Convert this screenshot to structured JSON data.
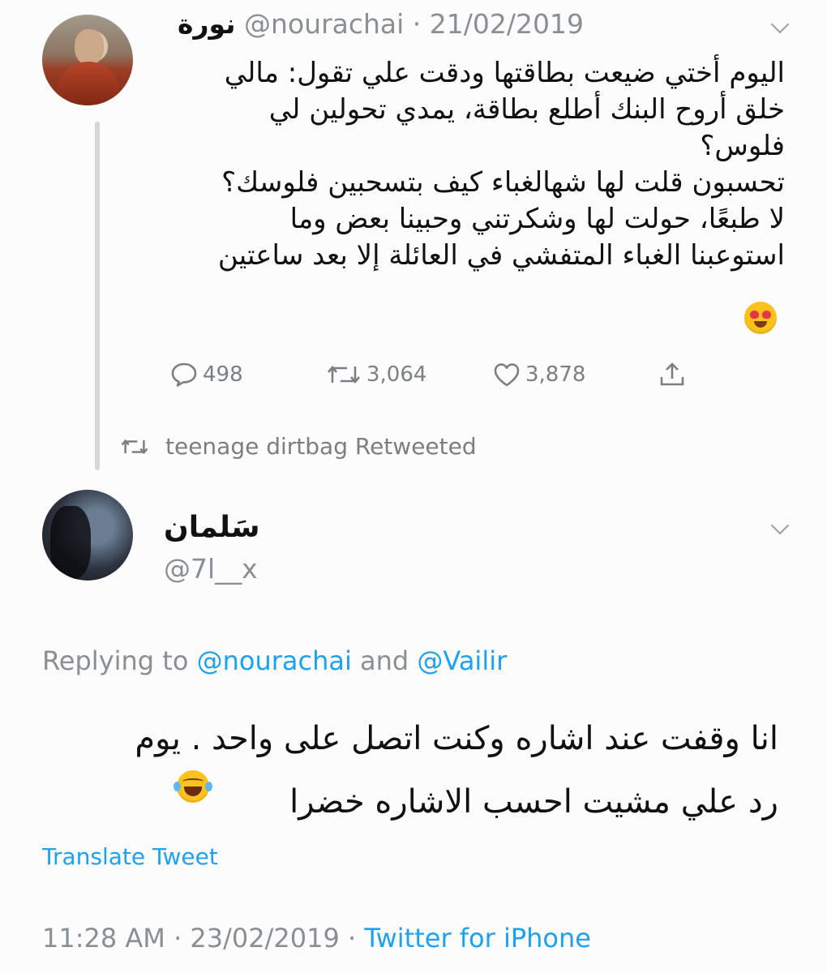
{
  "tweet1": {
    "display_name": "نورة",
    "handle": "@nourachai",
    "separator": " · ",
    "date": "21/02/2019",
    "text_lines": [
      "اليوم أختي ضيعت بطاقتها ودقت علي تقول: مالي",
      "خلق أروح البنك أطلع بطاقة، يمدي تحولين لي",
      "فلوس؟",
      "تحسبون قلت لها شهالغباء كيف بتسحبين فلوسك؟",
      "لا طبعًا، حولت لها وشكرتني وحبينا بعض وما",
      "استوعبنا الغباء المتفشي في العائلة إلا بعد ساعتين"
    ],
    "emoji": "heart-eyes-emoji",
    "actions": {
      "replies": "498",
      "retweets": "3,064",
      "likes": "3,878"
    }
  },
  "retweet_notice": {
    "icon": "retweet-icon",
    "text": "teenage dirtbag Retweeted"
  },
  "tweet2": {
    "display_name": "سَلمان",
    "handle": "@7l__x",
    "replying_prefix": "Replying to ",
    "replying_user1": "@nourachai",
    "replying_and": " and ",
    "replying_user2": "@Vailir",
    "text_lines": [
      "انا وقفت عند اشاره وكنت اتصل على واحد . يوم",
      "رد علي مشيت احسب الاشاره خضرا"
    ],
    "emoji": "tears-of-joy-emoji",
    "translate_label": "Translate Tweet",
    "time": "11:28 AM",
    "separator": " · ",
    "date": "23/02/2019",
    "source": "Twitter for iPhone"
  },
  "colors": {
    "link": "#1da1f2",
    "muted": "#8a8f95",
    "text": "#111111"
  }
}
